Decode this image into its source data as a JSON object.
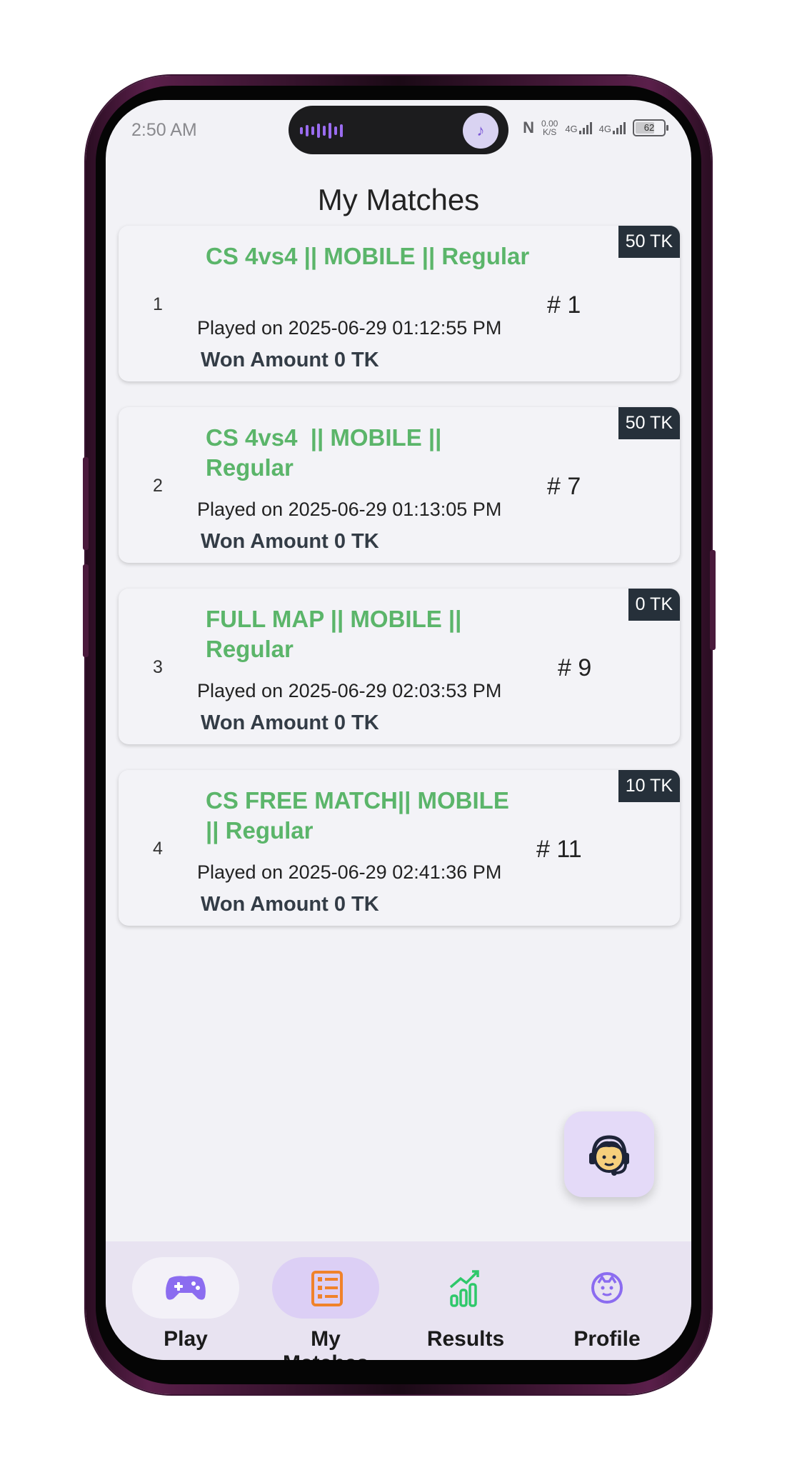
{
  "status_bar": {
    "time": "2:50 AM",
    "nfc": "N",
    "net_speed": "0.00",
    "net_unit": "K/S",
    "sim1": "4G",
    "sim2": "4G",
    "battery": "62"
  },
  "page": {
    "title": "My Matches"
  },
  "matches": [
    {
      "index": "1",
      "title": "CS 4vs4 || MOBILE || Regular",
      "played": "Played on 2025-06-29 01:12:55 PM",
      "won": "Won Amount 0 TK",
      "rank": "# 1",
      "fee": "50 TK"
    },
    {
      "index": "2",
      "title": "CS 4vs4  || MOBILE || Regular",
      "played": "Played on 2025-06-29 01:13:05 PM",
      "won": "Won Amount 0 TK",
      "rank": "# 7",
      "fee": "50 TK"
    },
    {
      "index": "3",
      "title": "FULL MAP || MOBILE || Regular",
      "played": "Played on 2025-06-29 02:03:53 PM",
      "won": "Won Amount 0 TK",
      "rank": "# 9",
      "fee": "0 TK"
    },
    {
      "index": "4",
      "title": "CS FREE MATCH|| MOBILE || Regular",
      "played": "Played on 2025-06-29 02:41:36 PM",
      "won": "Won Amount 0 TK",
      "rank": "# 11",
      "fee": "10 TK"
    }
  ],
  "fab": {
    "icon": "support-agent-icon"
  },
  "nav": [
    {
      "label": "Play",
      "icon": "gamepad-icon",
      "active": false
    },
    {
      "label": "My Matches",
      "icon": "list-icon",
      "active": true
    },
    {
      "label": "Results",
      "icon": "chart-icon",
      "active": false
    },
    {
      "label": "Profile",
      "icon": "profile-icon",
      "active": false
    }
  ],
  "colors": {
    "accent_green": "#5bb56a",
    "fee_badge": "#26303a",
    "nav_active": "#dccff5",
    "nav_bg": "#e8e3f1",
    "play_icon": "#8b6cf0",
    "matches_icon": "#f0822a",
    "results_icon": "#2fc86a",
    "profile_icon": "#8b6cf0"
  }
}
